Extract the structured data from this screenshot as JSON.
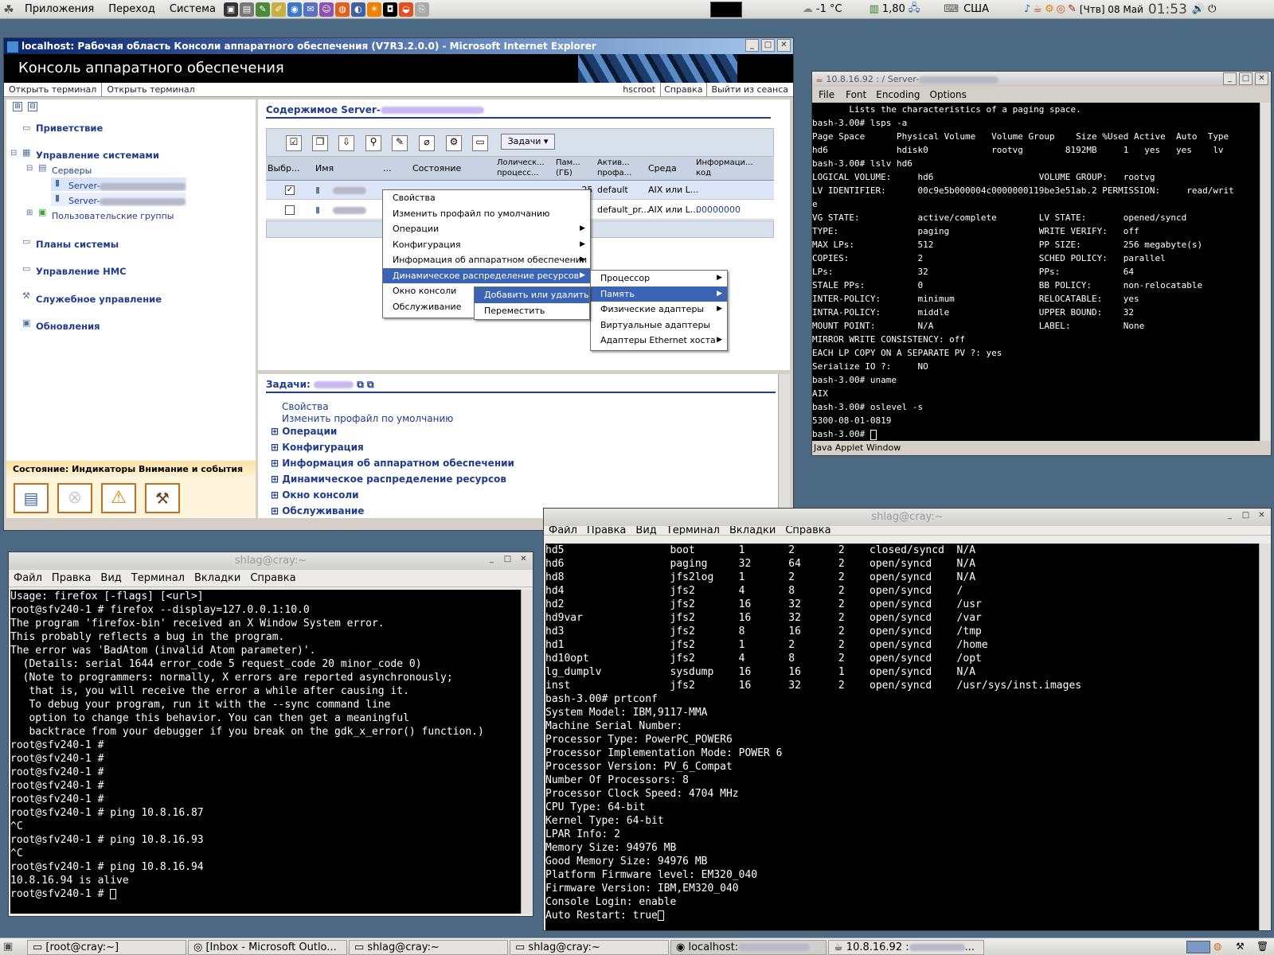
{
  "top_panel": {
    "menus": [
      "Приложения",
      "Переход",
      "Система"
    ],
    "temperature": "-1 °C",
    "cpu_freq": "1,80",
    "keyboard": "США",
    "date": "[Чтв] 08 Май",
    "time": "01:53"
  },
  "ie_window": {
    "title": "localhost: Рабочая область Консоли аппаратного обеспечения (V7R3.2.0.0) - Microsoft Internet Explorer",
    "banner": "Консоль аппаратного обеспечения",
    "links_left": [
      "Открыть терминал",
      "Открыть терминал"
    ],
    "links_right": [
      "hscroot",
      "Справка",
      "Выйти из сеанса"
    ],
    "nav": {
      "welcome": "Приветствие",
      "systems_mgmt": "Управление системами",
      "servers": "Серверы",
      "server1": "Server-",
      "server2": "Server-",
      "user_groups": "Пользовательские группы",
      "system_plans": "Планы системы",
      "hmc_mgmt": "Управление HMC",
      "service_mgmt": "Служебное управление",
      "updates": "Обновления"
    },
    "status_title": "Состояние: Индикаторы Внимание и события",
    "content_title": "Содержимое Server-",
    "tasks_button": "Задачи",
    "table": {
      "headers": [
        "Выбр...",
        "Имя",
        "...",
        "Состояние",
        "Лолическ... процесс...",
        "Пам... (ГБ)",
        "Актив... профа...",
        "Среда",
        "Информаци... код"
      ],
      "rows": [
        {
          "checked": true,
          "mem": ",25",
          "profile": "default",
          "env": "AIX или L...",
          "code": ""
        },
        {
          "checked": false,
          "mem": "0",
          "profile": "default_pr...",
          "env": "AIX или L...",
          "code": "00000000"
        }
      ]
    },
    "context_menu": [
      "Свойства",
      "Изменить профайл по умолчанию",
      "Операции",
      "Конфигурация",
      "Информация об аппаратном обеспечении",
      "Динамическое распределение ресурсов",
      "Окно консоли",
      "Обслуживание"
    ],
    "submenu_dlpar": [
      "Процессор",
      "Память",
      "Физические адаптеры",
      "Виртуальные адаптеры",
      "Адаптеры Ethernet хоста"
    ],
    "submenu_memory": [
      "Добавить или удалить",
      "Переместить"
    ],
    "tasks_title": "Задачи:",
    "task_links": [
      "Свойства",
      "Изменить профайл по умолчанию"
    ],
    "task_groups": [
      "Операции",
      "Конфигурация",
      "Информация об аппаратном обеспечении",
      "Динамическое распределение ресурсов",
      "Окно консоли",
      "Обслуживание"
    ]
  },
  "java_window": {
    "title": "10.8.16.92 :            / Server-",
    "menus": [
      "File",
      "Font",
      "Encoding",
      "Options"
    ],
    "status": "Java Applet Window",
    "lines": [
      "       Lists the characteristics of a paging space.",
      "bash-3.00# lsps -a",
      "Page Space      Physical Volume   Volume Group    Size %Used Active  Auto  Type",
      "hd6             hdisk0            rootvg        8192MB     1   yes   yes    lv",
      "bash-3.00# lslv hd6",
      "LOGICAL VOLUME:     hd6                    VOLUME GROUP:   rootvg",
      "LV IDENTIFIER:      00c9e5b000004c0000000119be3e51ab.2 PERMISSION:     read/writ",
      "e",
      "VG STATE:           active/complete        LV STATE:       opened/syncd",
      "TYPE:               paging                 WRITE VERIFY:   off",
      "MAX LPs:            512                    PP SIZE:        256 megabyte(s)",
      "COPIES:             2                      SCHED POLICY:   parallel",
      "LPs:                32                     PPs:            64",
      "STALE PPs:          0                      BB POLICY:      non-relocatable",
      "INTER-POLICY:       minimum                RELOCATABLE:    yes",
      "INTRA-POLICY:       middle                 UPPER BOUND:    32",
      "MOUNT POINT:        N/A                    LABEL:          None",
      "MIRROR WRITE CONSISTENCY: off",
      "EACH LP COPY ON A SEPARATE PV ?: yes",
      "Serialize IO ?:     NO",
      "bash-3.00# uname",
      "AIX",
      "bash-3.00# oslevel -s",
      "5300-08-01-0819",
      "bash-3.00# "
    ]
  },
  "term_right": {
    "title": "shlag@cray:~",
    "menus": [
      "Файл",
      "Правка",
      "Вид",
      "Терминал",
      "Вкладки",
      "Справка"
    ],
    "lines": [
      "hd5                 boot       1       2       2    closed/syncd  N/A",
      "hd6                 paging     32      64      2    open/syncd    N/A",
      "hd8                 jfs2log    1       2       2    open/syncd    N/A",
      "hd4                 jfs2       4       8       2    open/syncd    /",
      "hd2                 jfs2       16      32      2    open/syncd    /usr",
      "hd9var              jfs2       16      32      2    open/syncd    /var",
      "hd3                 jfs2       8       16      2    open/syncd    /tmp",
      "hd1                 jfs2       1       2       2    open/syncd    /home",
      "hd10opt             jfs2       4       8       2    open/syncd    /opt",
      "lg_dumplv           sysdump    16      16      1    open/syncd    N/A",
      "inst                jfs2       16      32      2    open/syncd    /usr/sys/inst.images",
      "bash-3.00# prtconf",
      "System Model: IBM,9117-MMA",
      "Machine Serial Number:",
      "Processor Type: PowerPC_POWER6",
      "Processor Implementation Mode: POWER 6",
      "Processor Version: PV_6_Compat",
      "Number Of Processors: 8",
      "Processor Clock Speed: 4704 MHz",
      "CPU Type: 64-bit",
      "Kernel Type: 64-bit",
      "LPAR Info: 2",
      "Memory Size: 94976 MB",
      "Good Memory Size: 94976 MB",
      "Platform Firmware level: EM320_040",
      "Firmware Version: IBM,EM320_040",
      "Console Login: enable",
      "Auto Restart: true"
    ]
  },
  "term_left": {
    "title": "shlag@cray:~",
    "menus": [
      "Файл",
      "Правка",
      "Вид",
      "Терминал",
      "Вкладки",
      "Справка"
    ],
    "lines": [
      "Usage: firefox [-flags] [<url>]",
      "root@sfv240-1 # firefox --display=127.0.0.1:10.0",
      "The program 'firefox-bin' received an X Window System error.",
      "This probably reflects a bug in the program.",
      "The error was 'BadAtom (invalid Atom parameter)'.",
      "  (Details: serial 1644 error_code 5 request_code 20 minor_code 0)",
      "  (Note to programmers: normally, X errors are reported asynchronously;",
      "   that is, you will receive the error a while after causing it.",
      "   To debug your program, run it with the --sync command line",
      "   option to change this behavior. You can then get a meaningful",
      "   backtrace from your debugger if you break on the gdk_x_error() function.)",
      "root@sfv240-1 #",
      "root@sfv240-1 #",
      "root@sfv240-1 #",
      "root@sfv240-1 #",
      "root@sfv240-1 #",
      "root@sfv240-1 # ping 10.8.16.87",
      "^C",
      "root@sfv240-1 # ping 10.8.16.93",
      "^C",
      "root@sfv240-1 # ping 10.8.16.94",
      "10.8.16.94 is alive",
      "root@sfv240-1 # "
    ]
  },
  "taskbar": {
    "items": [
      "[root@cray:~]",
      "[Inbox - Microsoft Outlo...",
      "shlag@cray:~",
      "shlag@cray:~",
      "localhost:",
      "10.8.16.92 :"
    ]
  }
}
